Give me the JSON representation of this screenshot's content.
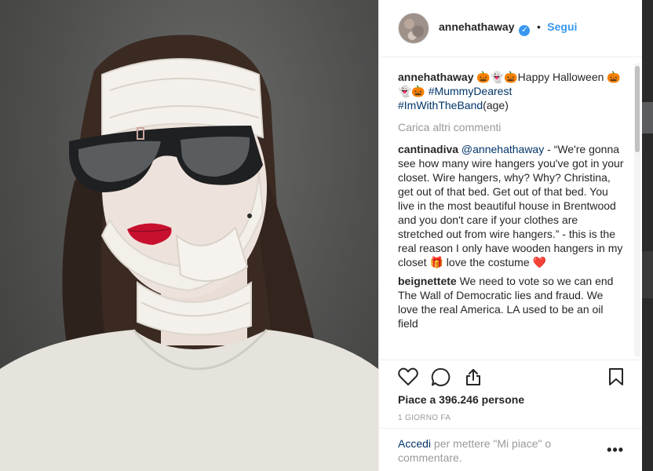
{
  "header": {
    "username": "annehathaway",
    "verified_mark": "✓",
    "separator": "•",
    "follow_label": "Segui"
  },
  "caption": {
    "username": "annehathaway",
    "emojis_a": "🎃👻🎃",
    "text_a": "Happy Halloween ",
    "emojis_b": "🎃👻🎃",
    "tag1": "#MummyDearest",
    "tag2": "#ImWithTheBand",
    "suffix": "(age)"
  },
  "load_more_label": "Carica altri commenti",
  "comments": [
    {
      "username": "cantinadiva",
      "mention": "@annehathaway",
      "text": " - “We're gonna see how many wire hangers you've got in your closet. Wire hangers, why? Why? Christina, get out of that bed. Get out of that bed. You live in the most beautiful house in Brentwood and you don't care if your clothes are stretched out from wire hangers.” - this is the real reason I only have wooden hangers in my closet ",
      "gift_emoji": "🎁",
      "text_end": " love the costume ",
      "heart_emoji": "❤️"
    },
    {
      "username": "beignettete",
      "text": " We need to vote so we can end The Wall of Democratic lies and fraud. We love the real America. LA used to be an oil field"
    }
  ],
  "actions": {
    "like_icon": "heart-outline-icon",
    "comment_icon": "comment-bubble-icon",
    "share_icon": "share-icon",
    "save_icon": "bookmark-icon",
    "likes_text": "Piace a 396.246 persone",
    "timestamp": "1 GIORNO FA"
  },
  "login": {
    "link": "Accedi",
    "text": " per mettere \"Mi piace\" o commentare.",
    "more_icon": "•••"
  },
  "colors": {
    "link_blue": "#3897f0",
    "hashtag_navy": "#003569",
    "muted_gray": "#999999",
    "text_dark": "#262626"
  }
}
